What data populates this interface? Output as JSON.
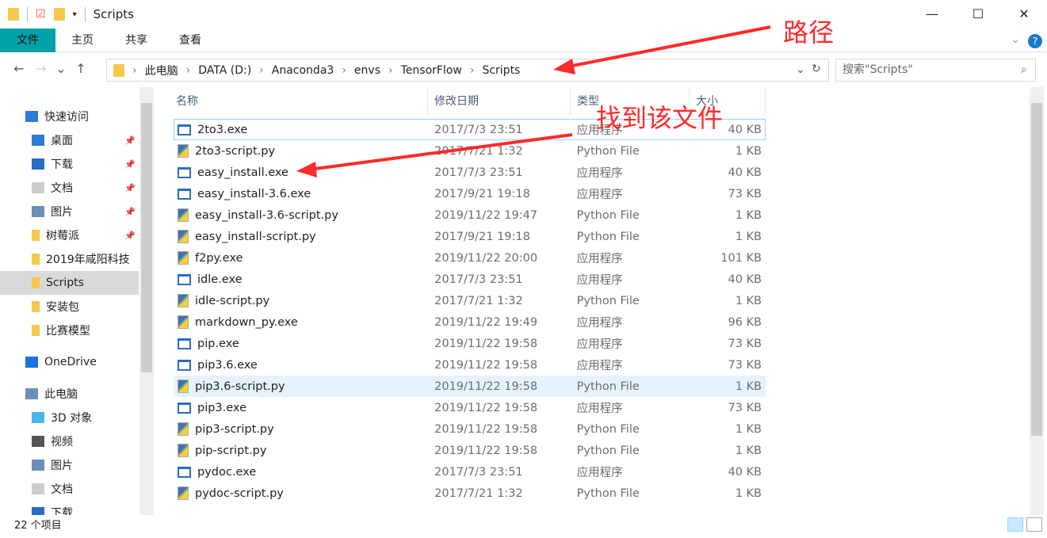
{
  "window": {
    "title": "Scripts",
    "minimize": "—",
    "maximize": "☐",
    "close": "✕"
  },
  "ribbon": {
    "tabs": [
      "文件",
      "主页",
      "共享",
      "查看"
    ],
    "help": "?"
  },
  "nav": {
    "back": "←",
    "forward": "→",
    "recent": "⌄",
    "up": "↑",
    "refresh": "↻",
    "dropdown": "⌄"
  },
  "address": {
    "crumbs": [
      "此电脑",
      "DATA (D:)",
      "Anaconda3",
      "envs",
      "TensorFlow",
      "Scripts"
    ]
  },
  "search": {
    "placeholder": "搜索\"Scripts\""
  },
  "sidebar": {
    "items": [
      {
        "label": "快速访问",
        "icon": "star-icon",
        "top": true
      },
      {
        "label": "桌面",
        "icon": "desktop-icon",
        "pin": true
      },
      {
        "label": "下载",
        "icon": "download-icon",
        "pin": true
      },
      {
        "label": "文档",
        "icon": "document-icon",
        "pin": true
      },
      {
        "label": "图片",
        "icon": "pictures-icon",
        "pin": true
      },
      {
        "label": "树莓派",
        "icon": "folder-icon",
        "pin": true
      },
      {
        "label": "2019年咸阳科技",
        "icon": "folder-icon"
      },
      {
        "label": "Scripts",
        "icon": "folder-icon",
        "selected": true
      },
      {
        "label": "安装包",
        "icon": "folder-icon"
      },
      {
        "label": "比赛模型",
        "icon": "folder-icon"
      },
      {
        "label": "OneDrive",
        "icon": "cloud-icon",
        "top": true
      },
      {
        "label": "此电脑",
        "icon": "computer-icon",
        "top": true
      },
      {
        "label": "3D 对象",
        "icon": "cube-icon"
      },
      {
        "label": "视频",
        "icon": "video-icon"
      },
      {
        "label": "图片",
        "icon": "pictures-icon"
      },
      {
        "label": "文档",
        "icon": "document-icon"
      },
      {
        "label": "下载",
        "icon": "download-icon"
      }
    ]
  },
  "columns": [
    "名称",
    "修改日期",
    "类型",
    "大小"
  ],
  "files": [
    {
      "name": "2to3.exe",
      "date": "2017/7/3 23:51",
      "type": "应用程序",
      "size": "40 KB",
      "icon": "exe"
    },
    {
      "name": "2to3-script.py",
      "date": "2017/7/21 1:32",
      "type": "Python File",
      "size": "1 KB",
      "icon": "py"
    },
    {
      "name": "easy_install.exe",
      "date": "2017/7/3 23:51",
      "type": "应用程序",
      "size": "40 KB",
      "icon": "exe"
    },
    {
      "name": "easy_install-3.6.exe",
      "date": "2017/9/21 19:18",
      "type": "应用程序",
      "size": "73 KB",
      "icon": "exe"
    },
    {
      "name": "easy_install-3.6-script.py",
      "date": "2019/11/22 19:47",
      "type": "Python File",
      "size": "1 KB",
      "icon": "py"
    },
    {
      "name": "easy_install-script.py",
      "date": "2017/9/21 19:18",
      "type": "Python File",
      "size": "1 KB",
      "icon": "py"
    },
    {
      "name": "f2py.exe",
      "date": "2019/11/22 20:00",
      "type": "应用程序",
      "size": "101 KB",
      "icon": "py"
    },
    {
      "name": "idle.exe",
      "date": "2017/7/3 23:51",
      "type": "应用程序",
      "size": "40 KB",
      "icon": "exe"
    },
    {
      "name": "idle-script.py",
      "date": "2017/7/21 1:32",
      "type": "Python File",
      "size": "1 KB",
      "icon": "py"
    },
    {
      "name": "markdown_py.exe",
      "date": "2019/11/22 19:49",
      "type": "应用程序",
      "size": "96 KB",
      "icon": "py"
    },
    {
      "name": "pip.exe",
      "date": "2019/11/22 19:58",
      "type": "应用程序",
      "size": "73 KB",
      "icon": "exe"
    },
    {
      "name": "pip3.6.exe",
      "date": "2019/11/22 19:58",
      "type": "应用程序",
      "size": "73 KB",
      "icon": "exe"
    },
    {
      "name": "pip3.6-script.py",
      "date": "2019/11/22 19:58",
      "type": "Python File",
      "size": "1 KB",
      "icon": "py",
      "hover": true
    },
    {
      "name": "pip3.exe",
      "date": "2019/11/22 19:58",
      "type": "应用程序",
      "size": "73 KB",
      "icon": "exe"
    },
    {
      "name": "pip3-script.py",
      "date": "2019/11/22 19:58",
      "type": "Python File",
      "size": "1 KB",
      "icon": "py"
    },
    {
      "name": "pip-script.py",
      "date": "2019/11/22 19:58",
      "type": "Python File",
      "size": "1 KB",
      "icon": "py"
    },
    {
      "name": "pydoc.exe",
      "date": "2017/7/3 23:51",
      "type": "应用程序",
      "size": "40 KB",
      "icon": "exe"
    },
    {
      "name": "pydoc-script.py",
      "date": "2017/7/21 1:32",
      "type": "Python File",
      "size": "1 KB",
      "icon": "py"
    }
  ],
  "status": {
    "count": "22 个项目"
  },
  "annotations": {
    "path": "路径",
    "find": "找到该文件",
    "color": "#ff2a2a"
  }
}
